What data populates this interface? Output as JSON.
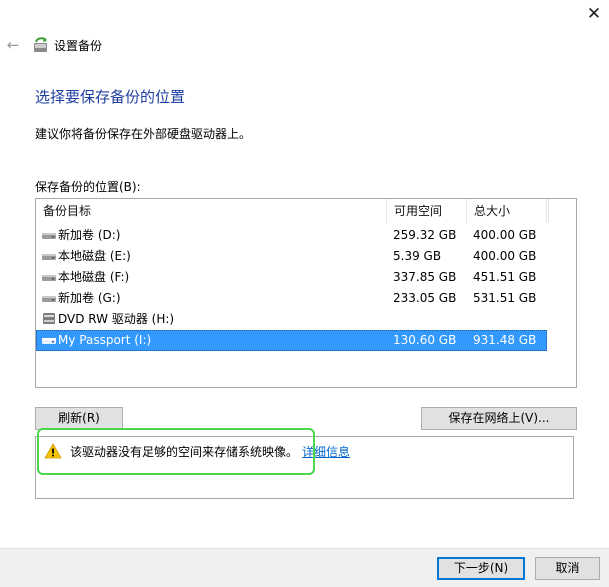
{
  "window": {
    "title": "设置备份",
    "close_glyph": "✕",
    "back_glyph": "←"
  },
  "page": {
    "heading": "选择要保存备份的位置",
    "description": "建议你将备份保存在外部硬盘驱动器上。",
    "list_label": "保存备份的位置(B):"
  },
  "list": {
    "columns": {
      "name": "备份目标",
      "free": "可用空间",
      "total": "总大小"
    },
    "rows": [
      {
        "name": "新加卷 (D:)",
        "free": "259.32 GB",
        "total": "400.00 GB",
        "icon": "hard-drive-icon"
      },
      {
        "name": "本地磁盘 (E:)",
        "free": "5.39 GB",
        "total": "400.00 GB",
        "icon": "hard-drive-icon"
      },
      {
        "name": "本地磁盘 (F:)",
        "free": "337.85 GB",
        "total": "451.51 GB",
        "icon": "hard-drive-icon"
      },
      {
        "name": "新加卷 (G:)",
        "free": "233.05 GB",
        "total": "531.51 GB",
        "icon": "hard-drive-icon"
      },
      {
        "name": "DVD RW 驱动器 (H:)",
        "free": "",
        "total": "",
        "icon": "dvd-drive-icon"
      },
      {
        "name": "My Passport (I:)",
        "free": "130.60 GB",
        "total": "931.48 GB",
        "icon": "usb-drive-icon",
        "selected": true
      }
    ]
  },
  "buttons": {
    "refresh": "刷新(R)",
    "save_network": "保存在网络上(V)...",
    "next": "下一步(N)",
    "cancel": "取消"
  },
  "warning": {
    "text": "该驱动器没有足够的空间来存储系统映像。",
    "link": "详细信息",
    "icon": "warning-icon"
  },
  "colors": {
    "heading": "#1f3fa0",
    "selection": "#3399ff",
    "link": "#0066cc",
    "highlight": "#4cd64c",
    "warning": "#f5c400"
  }
}
